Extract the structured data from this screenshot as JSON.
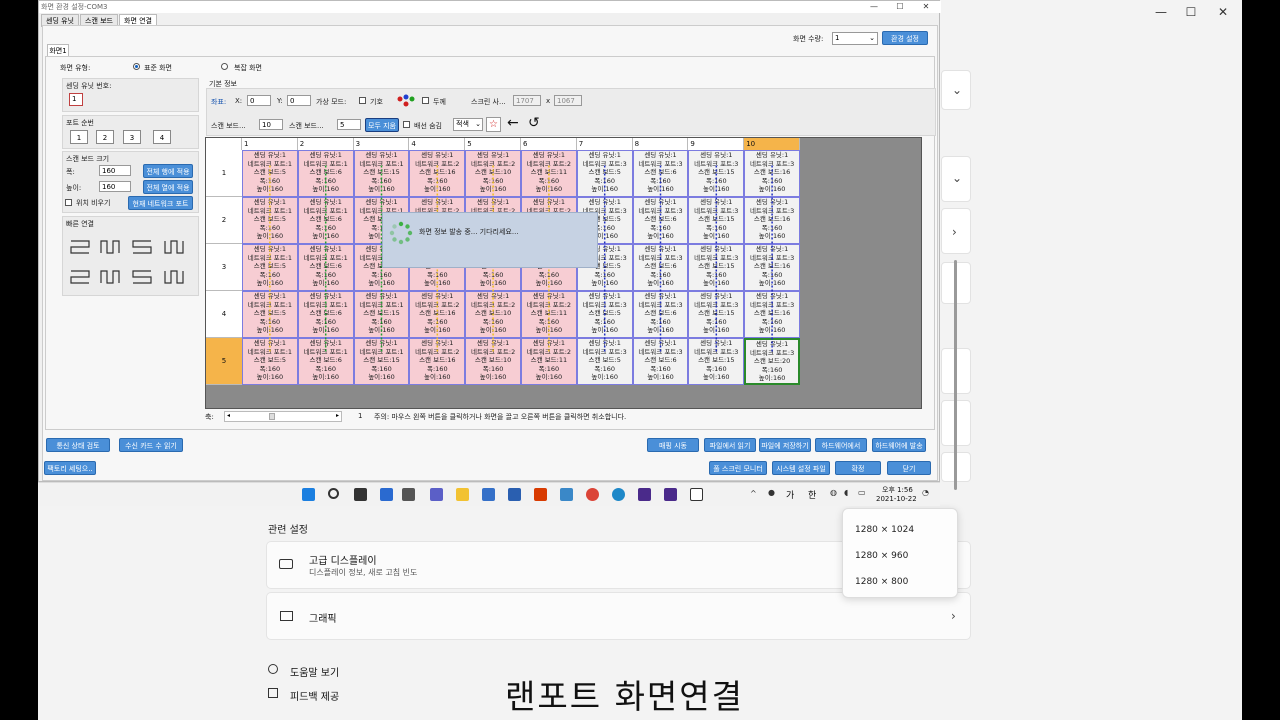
{
  "bg_window": {
    "related_settings": "관련 설정",
    "advanced_display": "고급 디스플레이",
    "advanced_display_sub": "디스플레이 정보, 새로 고침 빈도",
    "graphics": "그래픽",
    "help": "도움말 보기",
    "feedback": "피드백 제공",
    "resolutions": [
      "1280 × 1024",
      "1280 × 960",
      "1280 × 800"
    ]
  },
  "app": {
    "title": "화면 환경 설정-COM3",
    "tabs": [
      "센딩 유닛",
      "스캔 보드",
      "화면 연결"
    ],
    "active_tab": 2,
    "sub_tab": "화면1",
    "screen_count_label": "화면 수량:",
    "screen_count_value": "1",
    "env_settings_btn": "환경 설정",
    "screen_type_label": "화면 유형:",
    "standard_screen": "표준 화면",
    "complex_screen": "복잡 화면",
    "sending_unit_no_label": "센딩 유닛 번호:",
    "sending_unit_no": "1",
    "port_order_label": "포트 순번",
    "ports": [
      "1",
      "2",
      "3",
      "4"
    ],
    "scan_board_size_label": "스캔 보드 크기",
    "width_label": "폭:",
    "width_value": "160",
    "height_label": "높이:",
    "height_value": "160",
    "apply_all_width": "전체 행에 적용",
    "apply_all_height": "전체 열에 적용",
    "hide_position": "위치 비우기",
    "current_network_port": "현재 네트워크 포트",
    "quick_connect_label": "빠른 연결",
    "basic_info_label": "기본 정보",
    "coord_label": "좌표:",
    "x_label": "X:",
    "x_value": "0",
    "y_label": "Y:",
    "y_value": "0",
    "virtual_label": "가상 모드:",
    "chk_1": "기호",
    "chk_2": "두께",
    "screen_size_label": "스크린 사...",
    "screen_w": "1707",
    "screen_x": "x",
    "screen_h": "1067",
    "scan_board_cols_label": "스캔 보드...",
    "scan_board_cols": "10",
    "scan_board_rows_label": "스캔 보드...",
    "scan_board_rows": "5",
    "clear_all_btn": "모두 지움",
    "hide_wiring": "배선 숨김",
    "color_select": "적색",
    "col_headers": [
      "1",
      "2",
      "3",
      "4",
      "5",
      "6",
      "7",
      "8",
      "9",
      "10"
    ],
    "row_headers": [
      "1",
      "2",
      "3",
      "4",
      "5"
    ],
    "selected_col": 9,
    "selected_row": 4,
    "cells": [
      [
        "센딩 유닛:1",
        "네트워크 포트:1",
        "스캔 보드:5",
        "폭:160",
        "높이:160"
      ],
      [
        "센딩 유닛:1",
        "네트워크 포트:1",
        "스캔 보드:6",
        "폭:160",
        "높이:160"
      ],
      [
        "센딩 유닛:1",
        "네트워크 포트:1",
        "스캔 보드:15",
        "폭:160",
        "높이:160"
      ],
      [
        "센딩 유닛:1",
        "네트워크 포트:2",
        "스캔 보드:16",
        "폭:160",
        "높이:160"
      ],
      [
        "센딩 유닛:1",
        "네트워크 포트:2",
        "스캔 보드:10",
        "폭:160",
        "높이:160"
      ],
      [
        "센딩 유닛:1",
        "네트워크 포트:2",
        "스캔 보드:11",
        "폭:160",
        "높이:160"
      ],
      [
        "센딩 유닛:1",
        "네트워크 포트:3",
        "스캔 보드:5",
        "폭:160",
        "높이:160"
      ],
      [
        "센딩 유닛:1",
        "네트워크 포트:3",
        "스캔 보드:6",
        "폭:160",
        "높이:160"
      ],
      [
        "센딩 유닛:1",
        "네트워크 포트:3",
        "스캔 보드:15",
        "폭:160",
        "높이:160"
      ],
      [
        "센딩 유닛:1",
        "네트워크 포트:3",
        "스캔 보드:16",
        "폭:160",
        "높이:160"
      ]
    ],
    "last_cell_board": "스캔 보드:20",
    "dialog_text": "화면 정보 발송 중... 기다리세요...",
    "scroll_label": "축:",
    "scroll_value": "1",
    "hint": "주의: 마우스 왼쪽 버튼을 클릭하거나 화면을 끌고 오른쪽 버튼을 클릭하면 취소합니다.",
    "comm_check": "통신 상태 검토",
    "recv_card_read": "수신 카드 수 읽기",
    "factory_reset": "팩토리 세팅으..",
    "hw_test": "매핑 시동",
    "load_file": "파일에서 읽기",
    "save_file": "파일에 저장하기",
    "read_hw": "하드웨어에서",
    "send_hw": "하드웨어에 발송",
    "all_screen_monitor": "풀 스크린 모니터",
    "system_file": "시스템 설정 파일",
    "confirm": "확정",
    "close": "닫기"
  },
  "taskbar": {
    "time": "오후 1:56",
    "date": "2021-10-22",
    "ime_1": "가",
    "ime_2": "한"
  },
  "caption": "랜포트 화면연결"
}
